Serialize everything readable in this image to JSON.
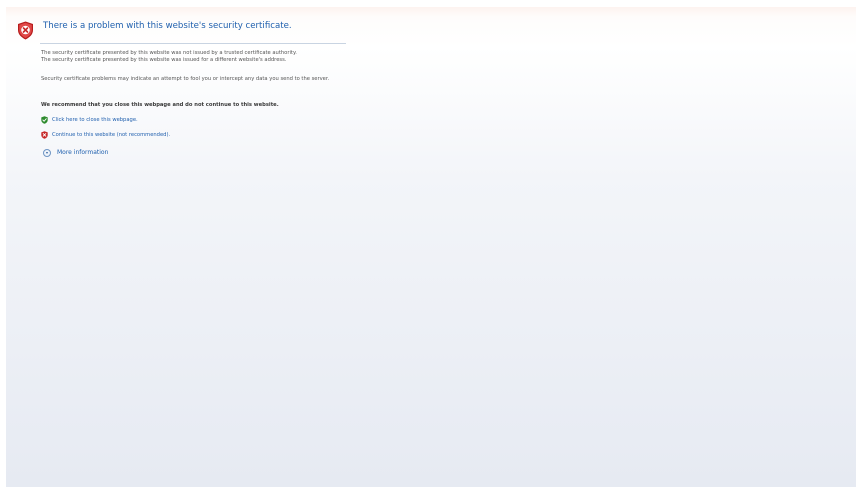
{
  "header": {
    "title": "There is a problem with this website's security certificate.",
    "icon": "shield-error-icon"
  },
  "body": {
    "line1": "The security certificate presented by this website was not issued by a trusted certificate authority.",
    "line2": "The security certificate presented by this website was issued for a different website's address.",
    "line3": "Security certificate problems may indicate an attempt to fool you or intercept any data you send to the server.",
    "recommendation": "We recommend that you close this webpage and do not continue to this website."
  },
  "actions": {
    "close_label": "Click here to close this webpage.",
    "close_icon": "green-shield-icon",
    "continue_label": "Continue to this website (not recommended).",
    "continue_icon": "red-shield-icon",
    "more_label": "More information"
  },
  "colors": {
    "link": "#1f5fae",
    "text": "#555555",
    "error": "#c62828",
    "safe": "#2e8b2e"
  }
}
